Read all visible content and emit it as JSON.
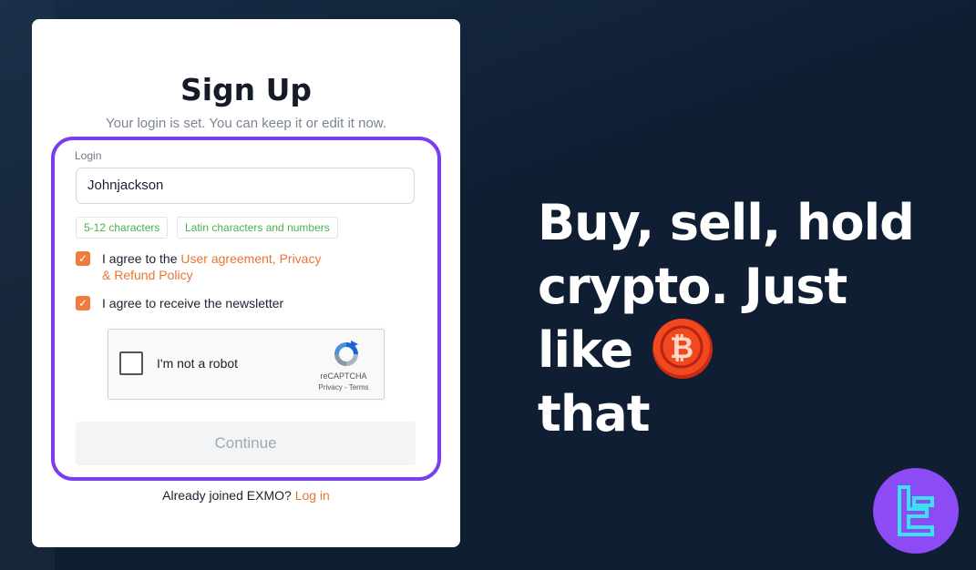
{
  "signup": {
    "title": "Sign Up",
    "subtitle": "Your login is set. You can keep it or edit it now.",
    "login_label": "Login",
    "login_value": "Johnjackson",
    "hints": [
      "5-12 characters",
      "Latin characters and numbers"
    ],
    "agree_prefix": "I agree to the ",
    "agree_link_1": "User agreement, Privacy",
    "agree_link_2": "& Refund Policy",
    "newsletter": "I agree to receive the newsletter",
    "continue_label": "Continue",
    "already_text": "Already joined EXMO?",
    "login_link": "Log in"
  },
  "captcha": {
    "label": "I'm not a robot",
    "brand": "reCAPTCHA",
    "links": "Privacy - Terms"
  },
  "promo": {
    "line1": "Buy, sell, hold",
    "line2": "crypto. Just like",
    "line3": "that"
  },
  "icons": {
    "checkbox_checked": "check-icon",
    "coin": "bitcoin-coin-icon",
    "badge": "brand-logo-icon"
  },
  "colors": {
    "accent_frame": "#7a3ef2",
    "link": "#e87534",
    "hint_text": "#4caf50",
    "background": "#0f1e33"
  }
}
